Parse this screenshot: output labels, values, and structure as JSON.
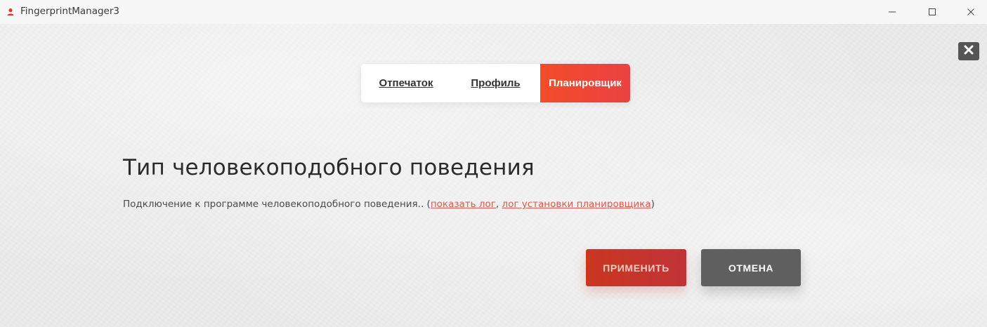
{
  "window": {
    "title": "FingerprintManager3",
    "icon": "app-person-icon",
    "controls": {
      "minimize_icon": "minimize-icon",
      "maximize_icon": "maximize-icon",
      "close_icon": "close-icon"
    }
  },
  "panel": {
    "close_icon": "close-x-icon"
  },
  "tabs": [
    {
      "label": "Отпечаток",
      "active": false
    },
    {
      "label": "Профиль",
      "active": false
    },
    {
      "label": "Планировщик",
      "active": true
    }
  ],
  "main": {
    "heading": "Тип человекоподобного поведения",
    "status_text": "Подключение к программе человекоподобного поведения..",
    "paren_open": "(",
    "link_show_log": "показать лог",
    "separator": ", ",
    "link_install_log": "лог установки планировщика",
    "paren_close": ")"
  },
  "buttons": {
    "apply_label": "ПРИМЕНИТЬ",
    "cancel_label": "ОТМЕНА"
  },
  "colors": {
    "accent": "#f04b30",
    "apply_bg": "#c6352a",
    "cancel_bg": "#5f5f5f",
    "link": "#e2574c"
  }
}
